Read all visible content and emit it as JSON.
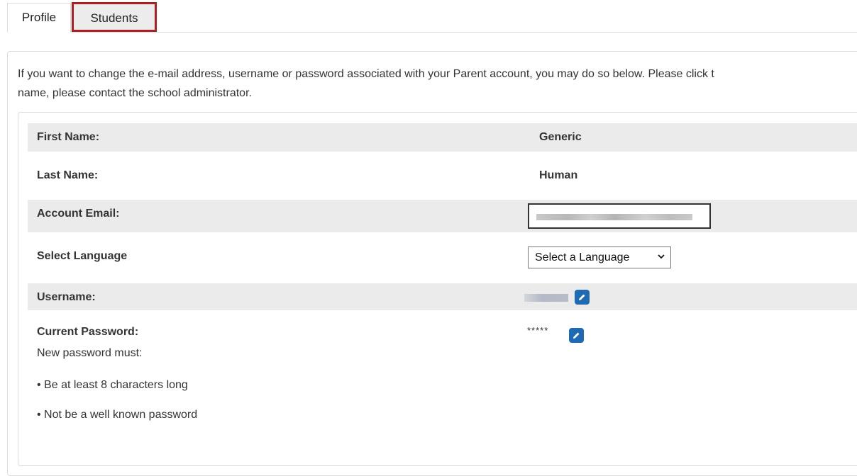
{
  "tabs": {
    "profile_label": "Profile",
    "students_label": "Students"
  },
  "intro": {
    "line1": "If you want to change the e-mail address, username or password associated with your Parent account, you may do so below. Please click t",
    "line2": "name, please contact the school administrator."
  },
  "profile": {
    "first_name_label": "First Name:",
    "first_name_value": "Generic",
    "last_name_label": "Last Name:",
    "last_name_value": "Human",
    "email_label": "Account Email:",
    "language_label": "Select Language",
    "language_selected": "Select a Language",
    "username_label": "Username:",
    "password_label": "Current Password:",
    "password_value": "*****",
    "requirements_heading": "New password must:",
    "requirements": [
      "• Be at least 8 characters long",
      "• Not be a well known password"
    ]
  },
  "colors": {
    "highlight_border": "#b01e23",
    "row_shade": "#ebebeb",
    "edit_icon_bg": "#1f6bb3"
  },
  "icons": {
    "edit": "pencil-icon",
    "dropdown": "chevron-down-icon"
  }
}
